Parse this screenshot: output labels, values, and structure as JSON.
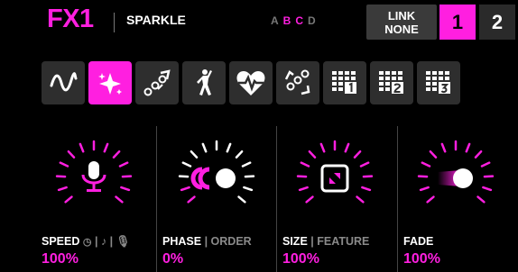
{
  "header": {
    "fx_title": "FX1",
    "preset_name": "SPARKLE",
    "pages": [
      "A",
      "B",
      "C",
      "D"
    ],
    "link_line1": "LINK",
    "link_line2": "NONE",
    "btn_1": "1",
    "btn_2": "2"
  },
  "modes": [
    {
      "icon": "sine-wave-icon"
    },
    {
      "icon": "sparkle-icon",
      "active": true
    },
    {
      "icon": "chase-dots-icon"
    },
    {
      "icon": "dancer-icon"
    },
    {
      "icon": "heartbeat-icon"
    },
    {
      "icon": "bounce-dots-icon"
    },
    {
      "icon": "grid-1-icon"
    },
    {
      "icon": "grid-2-icon"
    },
    {
      "icon": "grid-3-icon"
    }
  ],
  "knobs": {
    "speed": {
      "label": "SPEED",
      "value": "100%"
    },
    "phase": {
      "label": "PHASE",
      "alt": "ORDER",
      "value": "0%"
    },
    "size": {
      "label": "SIZE",
      "alt": "FEATURE",
      "value": "100%"
    },
    "fade": {
      "label": "FADE",
      "value": "100%"
    }
  },
  "colors": {
    "accent": "#ff1fe0",
    "panel": "#2e2e2e",
    "background": "#000000"
  }
}
